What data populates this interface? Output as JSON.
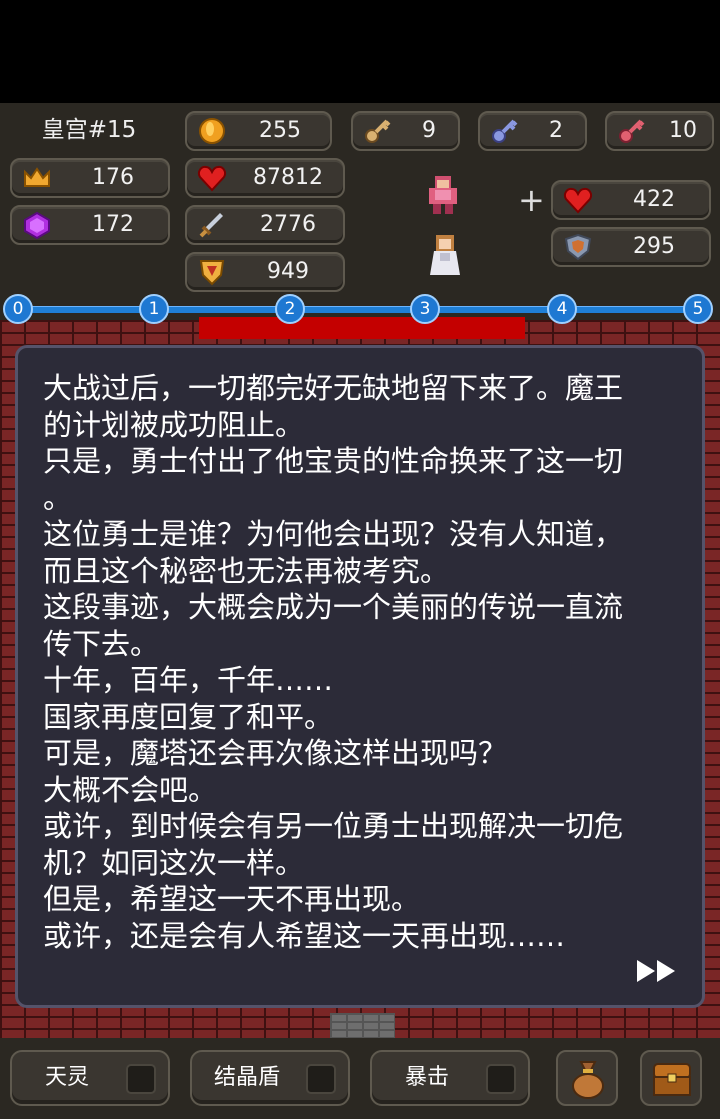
{
  "floor": {
    "label": "皇宫#15"
  },
  "stats": {
    "gold": "255",
    "key_yellow": "9",
    "key_blue": "2",
    "key_red": "10",
    "level": "176",
    "hp": "87812",
    "gem": "172",
    "attack": "2776",
    "defense": "949",
    "bonus_plus": "+",
    "bonus_hp": "422",
    "bonus_defense": "295"
  },
  "progress": {
    "nodes": [
      "0",
      "1",
      "2",
      "3",
      "4",
      "5"
    ],
    "highlight_from": "2",
    "highlight_to": "3"
  },
  "dialog": {
    "lines": [
      "大战过后，一切都完好无缺地留下来了。魔王",
      "的计划被成功阻止。",
      "只是，勇士付出了他宝贵的性命换来了这一切",
      "。",
      "这位勇士是谁？为何他会出现？没有人知道，",
      "而且这个秘密也无法再被考究。",
      "这段事迹，大概会成为一个美丽的传说一直流",
      "传下去。",
      "十年，百年，千年……",
      "国家再度回复了和平。",
      "可是，魔塔还会再次像这样出现吗？",
      "大概不会吧。",
      "或许，到时候会有另一位勇士出现解决一切危",
      "机？如同这次一样。",
      "但是，希望这一天不再出现。",
      "或许，还是会有人希望这一天再出现……"
    ]
  },
  "skills": {
    "skill1": "天灵",
    "skill2": "结晶盾",
    "skill3": "暴击"
  },
  "icons": {
    "gold": "coin-icon",
    "yellow_key": "yellow-key-icon",
    "blue_key": "blue-key-icon",
    "red_key": "red-key-icon",
    "level": "crown-icon",
    "hp": "heart-icon",
    "gem": "gem-icon",
    "attack": "sword-icon",
    "defense": "shield-icon",
    "hero": "hero-sprite",
    "princess": "princess-sprite",
    "next": "fast-forward-icon",
    "bag": "bag-icon",
    "chest": "chest-icon"
  },
  "colors": {
    "hud_bg": "#2b2822",
    "dialog_bg": "#2c2b38",
    "progress_blue": "#1e78d2",
    "progress_red": "#c40000",
    "brick": "#7a2626"
  }
}
